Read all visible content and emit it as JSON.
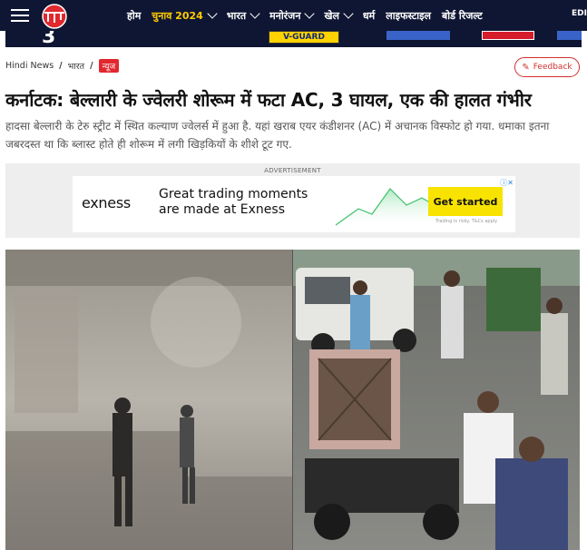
{
  "nav": {
    "items": [
      {
        "label": "होम",
        "dropdown": false,
        "accent": false
      },
      {
        "label": "चुनाव 2024",
        "dropdown": true,
        "accent": true
      },
      {
        "label": "भारत",
        "dropdown": true,
        "accent": false
      },
      {
        "label": "मनोरंजन",
        "dropdown": true,
        "accent": false
      },
      {
        "label": "खेल",
        "dropdown": true,
        "accent": false
      },
      {
        "label": "धर्म",
        "dropdown": false,
        "accent": false
      },
      {
        "label": "लाइफस्टाइल",
        "dropdown": false,
        "accent": false
      },
      {
        "label": "बोर्ड रिजल्ट",
        "dropdown": false,
        "accent": false
      }
    ],
    "edition": "EDI",
    "logo_text": "आज तक"
  },
  "top_ad": {
    "number": "3",
    "brand": "V-GUARD"
  },
  "breadcrumb": {
    "home": "Hindi News",
    "section": "भारत",
    "badge": "न्यूज"
  },
  "feedback_label": "Feedback",
  "article": {
    "headline": "कर्नाटक: बेल्लारी के ज्वेलरी शोरूम में फटा AC, 3 घायल, एक की हालत गंभीर",
    "summary": "हादसा बेल्लारी के टेरु स्ट्रीट में स्थित कल्याण ज्वेलर्स में हुआ है. यहां खराब एयर कंडीशनर (AC) में अचानक विस्फोट हो गया. धमाका इतना जबरदस्त था कि ब्लास्ट होते ही शोरूम में लगी खिड़कियों के शीशे टूट गए."
  },
  "ad": {
    "label": "ADVERTISEMENT",
    "brand": "exness",
    "tagline_line1": "Great trading moments",
    "tagline_line2": "are made at Exness",
    "cta": "Get started",
    "risk": "Trading is risky. T&Cs apply",
    "brand_color": "#f8e300"
  },
  "colors": {
    "nav_bg": "#0f1633",
    "accent": "#ffcc00",
    "brand_red": "#e0282e"
  }
}
